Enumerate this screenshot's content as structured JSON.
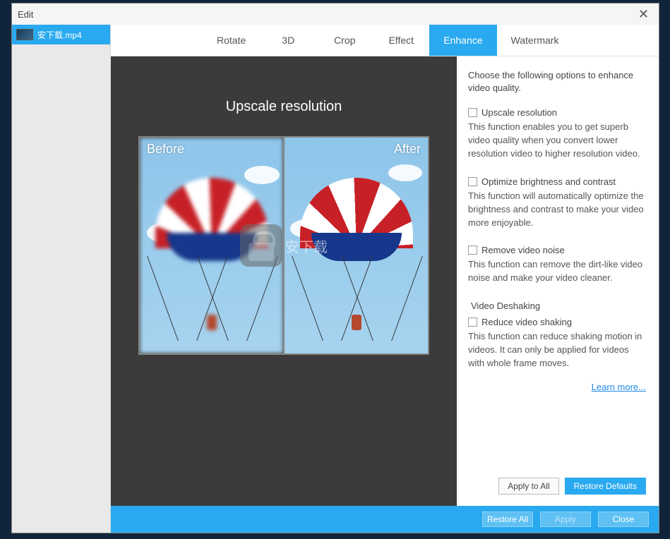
{
  "window": {
    "title": "Edit"
  },
  "sidebar": {
    "file_tab": {
      "name": "安下载.mp4"
    }
  },
  "tabs": [
    {
      "label": "Rotate",
      "active": false
    },
    {
      "label": "3D",
      "active": false
    },
    {
      "label": "Crop",
      "active": false
    },
    {
      "label": "Effect",
      "active": false
    },
    {
      "label": "Enhance",
      "active": true
    },
    {
      "label": "Watermark",
      "active": false
    }
  ],
  "preview": {
    "title": "Upscale resolution",
    "before_label": "Before",
    "after_label": "After",
    "watermark_text": "安下载"
  },
  "options": {
    "intro": "Choose the following options to enhance video quality.",
    "items": [
      {
        "label": "Upscale resolution",
        "desc": "This function enables you to get superb video quality when you convert lower resolution video to higher resolution video."
      },
      {
        "label": "Optimize brightness and contrast",
        "desc": "This function will automatically optimize the brightness and contrast to make your video more enjoyable."
      },
      {
        "label": "Remove video noise",
        "desc": "This function can remove the dirt-like video noise and make your video cleaner."
      }
    ],
    "deshaking_heading": "Video Deshaking",
    "deshaking": {
      "label": "Reduce video shaking",
      "desc": "This function can reduce shaking motion in videos. It can only be applied for videos with whole frame moves."
    },
    "learn_more": "Learn more...",
    "buttons": {
      "apply_all": "Apply to All",
      "restore_defaults": "Restore Defaults"
    }
  },
  "footer": {
    "restore_all": "Restore All",
    "apply": "Apply",
    "close": "Close"
  }
}
